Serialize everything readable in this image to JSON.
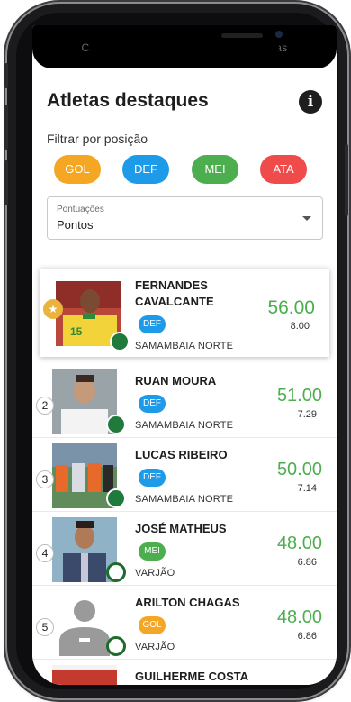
{
  "header": {
    "topbar_text": "Classificação · Pontuações · Estatísticas",
    "title": "Atletas destaques",
    "info_icon": "info-icon"
  },
  "filter": {
    "label": "Filtrar por posição",
    "positions": [
      {
        "label": "GOL",
        "color": "#f5a623"
      },
      {
        "label": "DEF",
        "color": "#1e9be8"
      },
      {
        "label": "MEI",
        "color": "#4cae4f"
      },
      {
        "label": "ATA",
        "color": "#ef4b4b"
      }
    ]
  },
  "sort_select": {
    "label": "Pontuações",
    "value": "Pontos"
  },
  "athletes": [
    {
      "rank": "★",
      "name_line1": "FERNANDES",
      "name_line2": "CAVALCANTE",
      "position": "DEF",
      "team": "SAMAMBAIA NORTE",
      "score": "56.00",
      "sub_score": "8.00"
    },
    {
      "rank": "2",
      "name_line1": "RUAN MOURA",
      "name_line2": "",
      "position": "DEF",
      "team": "SAMAMBAIA NORTE",
      "score": "51.00",
      "sub_score": "7.29"
    },
    {
      "rank": "3",
      "name_line1": "LUCAS RIBEIRO",
      "name_line2": "",
      "position": "DEF",
      "team": "SAMAMBAIA NORTE",
      "score": "50.00",
      "sub_score": "7.14"
    },
    {
      "rank": "4",
      "name_line1": "JOSÉ MATHEUS",
      "name_line2": "",
      "position": "MEI",
      "team": "VARJÃO",
      "score": "48.00",
      "sub_score": "6.86"
    },
    {
      "rank": "5",
      "name_line1": "ARILTON CHAGAS",
      "name_line2": "",
      "position": "GOL",
      "team": "VARJÃO",
      "score": "48.00",
      "sub_score": "6.86"
    },
    {
      "rank": "",
      "name_line1": "GUILHERME COSTA",
      "name_line2": "",
      "position": "",
      "team": "",
      "score": "",
      "sub_score": ""
    }
  ],
  "colors": {
    "score_green": "#4cae4f",
    "star_gold": "#eab33c"
  }
}
